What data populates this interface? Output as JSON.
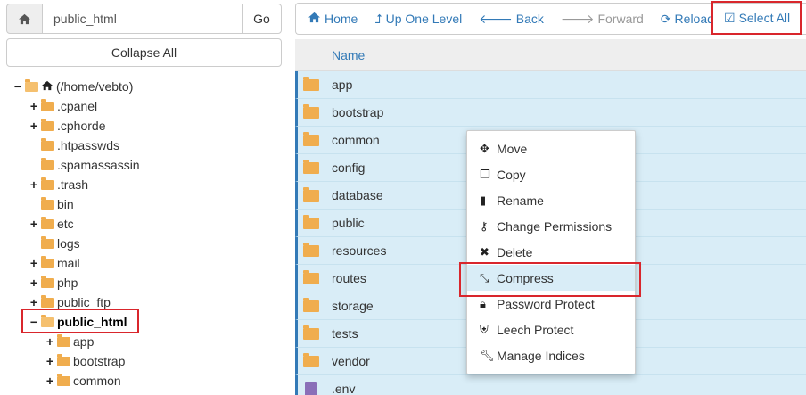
{
  "address_bar": {
    "value": "public_html",
    "go_label": "Go",
    "home_icon": "home-icon"
  },
  "collapse_all_label": "Collapse All",
  "tree": {
    "root_label": "(/home/vebto)",
    "items": [
      {
        "label": ".cpanel",
        "toggle": "+"
      },
      {
        "label": ".cphorde",
        "toggle": "+"
      },
      {
        "label": ".htpasswds",
        "toggle": ""
      },
      {
        "label": ".spamassassin",
        "toggle": ""
      },
      {
        "label": ".trash",
        "toggle": "+"
      },
      {
        "label": "bin",
        "toggle": ""
      },
      {
        "label": "etc",
        "toggle": "+"
      },
      {
        "label": "logs",
        "toggle": ""
      },
      {
        "label": "mail",
        "toggle": "+"
      },
      {
        "label": "php",
        "toggle": "+"
      },
      {
        "label": "public_ftp",
        "toggle": "+"
      },
      {
        "label": "public_html",
        "toggle": "−",
        "selected": true
      },
      {
        "label": "app",
        "toggle": "+"
      },
      {
        "label": "bootstrap",
        "toggle": "+"
      },
      {
        "label": "common",
        "toggle": "+"
      }
    ]
  },
  "toolbar": {
    "home": "Home",
    "up": "Up One Level",
    "back": "Back",
    "forward": "Forward",
    "reload": "Reload",
    "select_all": "Select All"
  },
  "list": {
    "header_name": "Name",
    "rows": [
      {
        "name": "app",
        "type": "folder"
      },
      {
        "name": "bootstrap",
        "type": "folder"
      },
      {
        "name": "common",
        "type": "folder"
      },
      {
        "name": "config",
        "type": "folder"
      },
      {
        "name": "database",
        "type": "folder"
      },
      {
        "name": "public",
        "type": "folder"
      },
      {
        "name": "resources",
        "type": "folder"
      },
      {
        "name": "routes",
        "type": "folder"
      },
      {
        "name": "storage",
        "type": "folder"
      },
      {
        "name": "tests",
        "type": "folder"
      },
      {
        "name": "vendor",
        "type": "folder"
      },
      {
        "name": ".env",
        "type": "file"
      }
    ]
  },
  "context_menu": {
    "items": [
      {
        "label": "Move",
        "icon": "move-icon"
      },
      {
        "label": "Copy",
        "icon": "copy-icon"
      },
      {
        "label": "Rename",
        "icon": "file-icon"
      },
      {
        "label": "Change Permissions",
        "icon": "key-icon"
      },
      {
        "label": "Delete",
        "icon": "close-icon"
      },
      {
        "label": "Compress",
        "icon": "compress-icon"
      },
      {
        "label": "Password Protect",
        "icon": "lock-icon"
      },
      {
        "label": "Leech Protect",
        "icon": "shield-icon"
      },
      {
        "label": "Manage Indices",
        "icon": "wrench-icon"
      }
    ]
  },
  "colors": {
    "accent": "#337ab7",
    "selected_row": "#d9edf7",
    "folder": "#f0ad4e",
    "highlight_outline": "#d9262c"
  }
}
